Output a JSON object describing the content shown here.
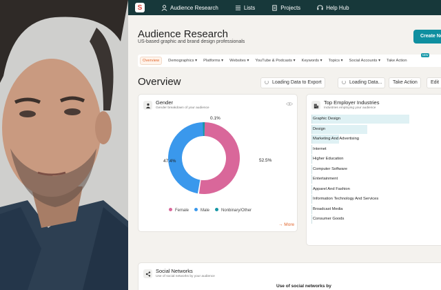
{
  "nav": {
    "items": [
      {
        "label": "Audience Research",
        "icon": "person-icon"
      },
      {
        "label": "Lists",
        "icon": "list-icon"
      },
      {
        "label": "Projects",
        "icon": "document-icon"
      },
      {
        "label": "Help Hub",
        "icon": "help-icon"
      }
    ]
  },
  "page": {
    "title": "Audience Research",
    "subtitle": "US-based graphic and brand design professionals",
    "create_label": "Create Ne"
  },
  "tabs": [
    {
      "label": "Overview",
      "active": true
    },
    {
      "label": "Demographics ▾"
    },
    {
      "label": "Platforms ▾"
    },
    {
      "label": "Websites ▾"
    },
    {
      "label": "YouTube & Podcasts ▾"
    },
    {
      "label": "Keywords ▾"
    },
    {
      "label": "Topics ▾"
    },
    {
      "label": "Social Accounts ▾"
    },
    {
      "label": "Take Action"
    }
  ],
  "new_badge": "NEW",
  "overview": {
    "title": "Overview",
    "actions": [
      "Loading Data to Export",
      "Loading Data...",
      "Take Action",
      "Edit"
    ]
  },
  "gender": {
    "title": "Gender",
    "subtitle": "Gender breakdown of your audience",
    "more": "→ More",
    "labels": {
      "female": "52.5%",
      "male": "47.4%",
      "nonbinary": "0.1%"
    },
    "legend": [
      "Female",
      "Male",
      "Nonbinary/Other"
    ],
    "colors": {
      "female": "#d9679a",
      "male": "#3a98ec",
      "nonbinary": "#1596a4"
    }
  },
  "chart_data": {
    "type": "pie",
    "categories": [
      "Female",
      "Male",
      "Nonbinary/Other"
    ],
    "values": [
      52.5,
      47.4,
      0.1
    ],
    "title": "Gender"
  },
  "industries": {
    "title": "Top Employer Industries",
    "subtitle": "Industries employing your audience",
    "items": [
      {
        "label": "Graphic Design",
        "share": 1.0
      },
      {
        "label": "Design",
        "share": 0.57
      },
      {
        "label": "Marketing And Advertising",
        "share": 0.28
      },
      {
        "label": "Internet",
        "share": 0
      },
      {
        "label": "Higher Education",
        "share": 0
      },
      {
        "label": "Computer Software",
        "share": 0
      },
      {
        "label": "Entertainment",
        "share": 0
      },
      {
        "label": "Apparel And Fashion",
        "share": 0
      },
      {
        "label": "Information Technology And Services",
        "share": 0
      },
      {
        "label": "Broadcast Media",
        "share": 0
      },
      {
        "label": "Consumer Goods",
        "share": 0
      }
    ]
  },
  "social": {
    "title": "Social Networks",
    "subtitle": "Use of social networks by your audience",
    "chart_title": "Use of social networks by"
  }
}
